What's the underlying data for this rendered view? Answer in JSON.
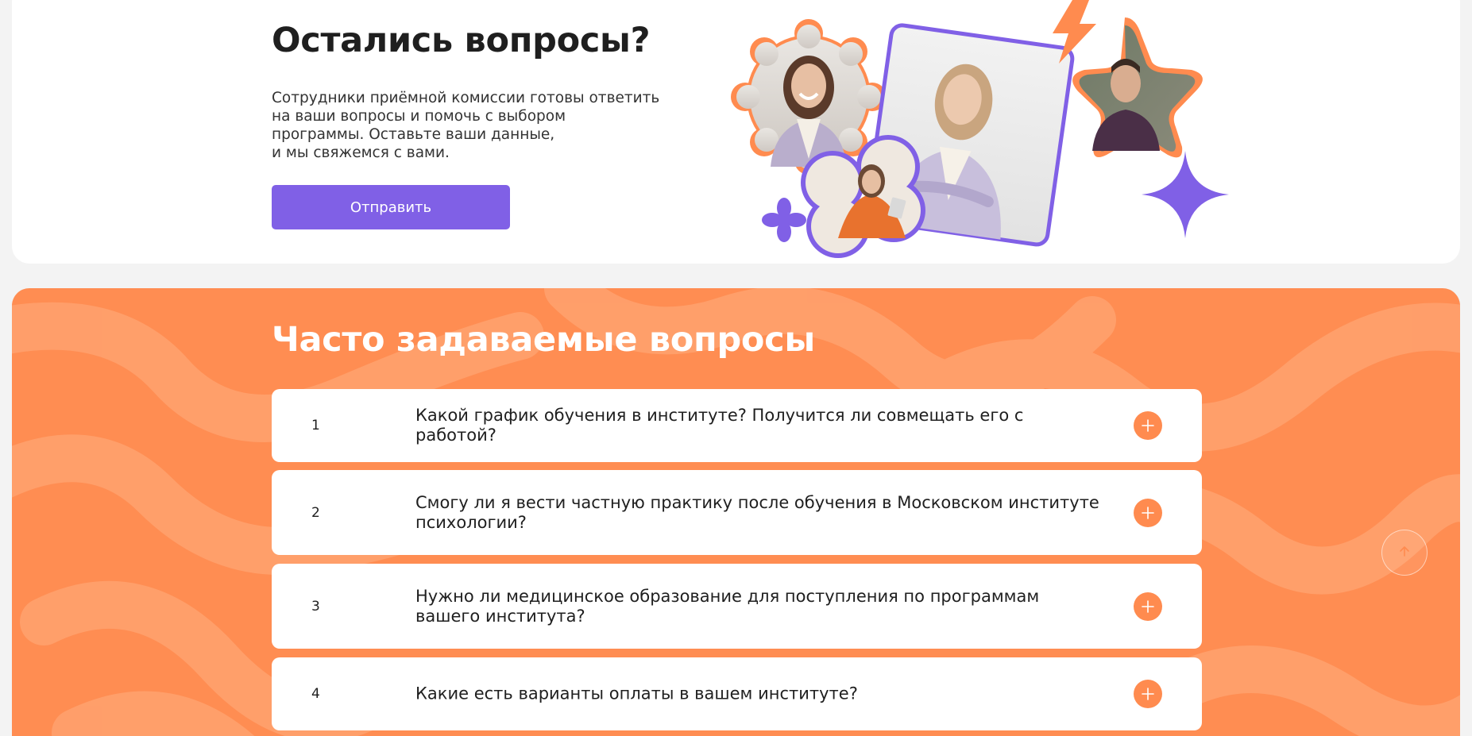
{
  "contact": {
    "title": "Остались вопросы?",
    "text_lines": [
      "Сотрудники приёмной комиссии готовы ответить",
      "на ваши вопросы и помочь с выбором",
      "программы. Оставьте ваши данные,",
      "и мы свяжемся с вами."
    ],
    "button_label": "Отправить"
  },
  "faq": {
    "title": "Часто задаваемые вопросы",
    "items": [
      {
        "num": "1",
        "question": "Какой график обучения в институте? Получится ли совмещать его с работой?"
      },
      {
        "num": "2",
        "question": "Смогу ли я вести частную практику после обучения в Московском институте психологии?"
      },
      {
        "num": "3",
        "question": "Нужно ли медицинское образование для поступления по программам вашего института?"
      },
      {
        "num": "4",
        "question": "Какие есть варианты оплаты в вашем институте?"
      }
    ]
  },
  "icons": {
    "faq_expand": "plus-icon",
    "scroll_top": "arrow-up-icon",
    "decor": [
      "lightning-icon",
      "sparkle-star-icon",
      "flower-icon"
    ]
  },
  "colors": {
    "accent_purple": "#8060e6",
    "accent_orange": "#ff8d52",
    "plus_orange": "#ff8b4f",
    "text_dark": "#1f1f1f",
    "page_bg": "#f3f3f3"
  }
}
